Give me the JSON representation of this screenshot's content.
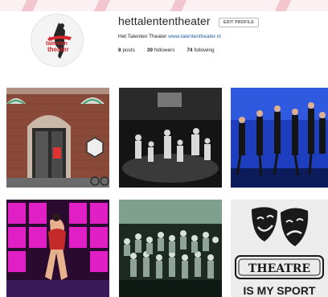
{
  "profile": {
    "username": "hettalententheater",
    "edit_profile_label": "EDIT PROFILE",
    "full_name": "Het Talenten Theater",
    "website": "www.talententheater.nl",
    "avatar_logo_text": [
      "het",
      "talenten",
      "theater"
    ]
  },
  "stats": {
    "posts_count": "8",
    "posts_label": "posts",
    "followers_count": "39",
    "followers_label": "followers",
    "following_count": "74",
    "following_label": "following"
  },
  "posts": [
    {
      "name": "post-1",
      "subject": "brick building entrance"
    },
    {
      "name": "post-2",
      "subject": "black and white dance performance"
    },
    {
      "name": "post-3",
      "subject": "dancers on blue stage"
    },
    {
      "name": "post-4",
      "subject": "dancer on magenta stage"
    },
    {
      "name": "post-5",
      "subject": "group choir on stage"
    },
    {
      "name": "post-6",
      "subject": "theatre masks graphic",
      "text_line1": "THEATRE",
      "text_line2": "IS MY SPORT"
    }
  ],
  "colors": {
    "link": "#1e5ea8",
    "logo_red": "#d7262d",
    "strip_pink": "#f3c6cf"
  }
}
